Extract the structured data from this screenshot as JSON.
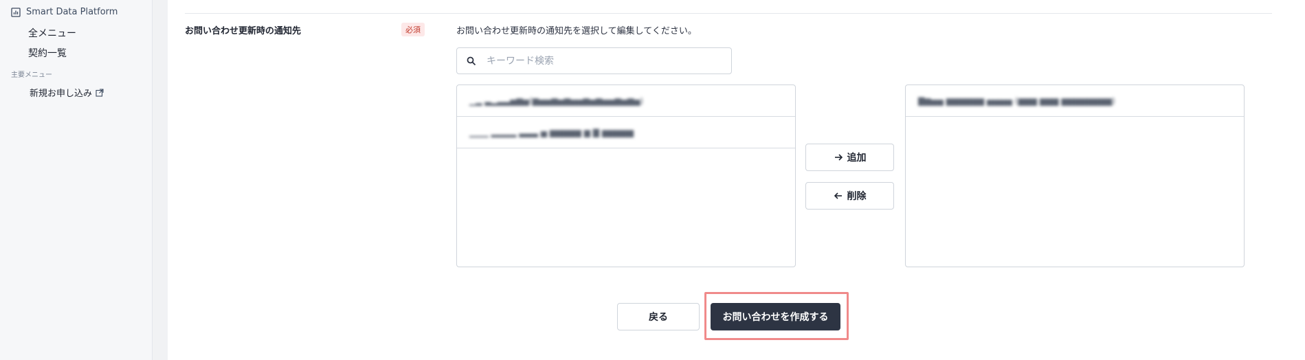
{
  "sidebar": {
    "platform_label": "Smart Data Platform",
    "items": [
      {
        "label": "全メニュー"
      },
      {
        "label": "契約一覧"
      }
    ],
    "section_label": "主要メニュー",
    "new_application_label": "新規お申し込み"
  },
  "form": {
    "field_label": "お問い合わせ更新時の通知先",
    "required_badge": "必須",
    "instruction": "お問い合わせ更新時の通知先を選択して編集してください。",
    "search": {
      "placeholder": "キーワード検索",
      "value": ""
    },
    "available_list": [
      {
        "label": "▁▂ ▃▂▃▃▅▆▅(▆▅▅▆▅▆▅▅▆▅▆▅▅▆▅▆▅)"
      },
      {
        "label": "▁▁▁ ▂▂▂▂ ▃▃▃ ▅ ▆▆▆▆▆ ▆ ▇ ▆▆▆▆▆"
      }
    ],
    "selected_list": [
      {
        "label": "▇▆▅▅ ▆▆▆▆▆▆ ▅▅▅▅ (▆▆▆ ▆▆▆ ▆▆▆▆▆▆▆▆)"
      }
    ],
    "add_button": "追加",
    "remove_button": "削除"
  },
  "actions": {
    "back_button": "戻る",
    "create_button": "お問い合わせを作成する"
  },
  "colors": {
    "primary_button": "#2d3443",
    "highlight": "#f08a8a",
    "required_badge_bg": "#fde8e8",
    "required_badge_text": "#c0392b"
  },
  "icons": {
    "platform": "chart-icon",
    "external_link": "external-link-icon",
    "search": "search-icon",
    "add": "arrow-right-icon",
    "remove": "arrow-left-icon"
  }
}
